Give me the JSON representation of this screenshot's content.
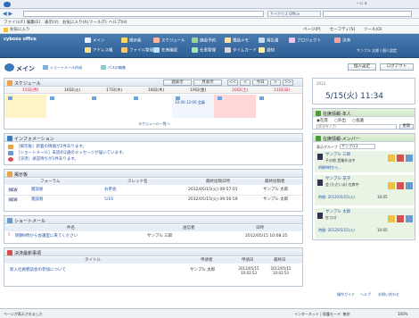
{
  "browser": {
    "nav_symbols": "◀ ▶",
    "menu": [
      "ファイル(F)",
      "編集(E)",
      "表示(V)",
      "お気に入り(A)",
      "ツール(T)",
      "ヘルプ(H)"
    ],
    "fav_label": "お気に入り",
    "tool_items": [
      "ページ(P)",
      "セーフティ(S)",
      "ツール(O)"
    ],
    "tab_title": "サイボウズ Office"
  },
  "app": {
    "logo": "cybozu office",
    "nav_row1": [
      "メイン",
      "掲示板",
      "スケジュール",
      "施設予約",
      "電話メモ",
      "報告書",
      "プロジェクト",
      "決済"
    ],
    "nav_row2": [
      "アドレス帳",
      "ファイル管理",
      "在席確認",
      "仕事管理",
      "タイムカード",
      "通知"
    ],
    "user_right": "サンプル 太郎 | 個人設定"
  },
  "breadcrumb": {
    "main": "メイン",
    "sub1": "ショートメール作成",
    "sub2": "パスの編集"
  },
  "header_buttons": {
    "personal": "個人設定",
    "logout": "ログアウト"
  },
  "schedule": {
    "title": "スケジュール",
    "views": [
      "週表示",
      "月表示"
    ],
    "pager": [
      "<<",
      "<",
      "今日",
      ">",
      ">>"
    ],
    "days": [
      "15日(月)",
      "16日(火)",
      "17日(水)",
      "18日(木)",
      "19日(金)",
      "20日(土)",
      "21日(日)"
    ],
    "event": "10:00-12:00 会議",
    "more": "スケジュール一覧へ"
  },
  "info": {
    "title": "インフォメーション",
    "items": [
      "［掲示板］新着の情報が2件あります。",
      "［ショートメール］未読の2通のメッセージが届いています。",
      "［決済］承認待ちが1件あります。"
    ]
  },
  "bbs": {
    "title": "掲示板",
    "columns": [
      "フォーラム",
      "スレッド名",
      "最終投稿日時",
      "最終投稿者"
    ],
    "rows": [
      {
        "badge": "NEW",
        "forum": "雑談板",
        "thread": "お茶会",
        "date": "2012/05/15(火) 09:57:01",
        "author": "サンプル 太郎"
      },
      {
        "badge": "NEW",
        "forum": "雑談板",
        "thread": "5/16",
        "date": "2012/05/15(火) 09:56:59",
        "author": "サンプル 太郎"
      }
    ]
  },
  "mail": {
    "title": "ショートメール",
    "columns": [
      "件名",
      "送信者",
      "日時"
    ],
    "rows": [
      {
        "subject": "明朝9時から会議室に来てください",
        "sender": "サンプル 三郎",
        "date": "2012/05/15 10:08:25"
      }
    ]
  },
  "approval": {
    "title": "決済最新事項",
    "columns": [
      "タイトル",
      "申請者",
      "申請日",
      "最終日"
    ],
    "rows": [
      {
        "title": "新入社員懇談会の参加について",
        "applicant": "サンプル 太郎",
        "applied": "2012/05/15 10:03:53",
        "last": "2012/05/15 10:03:53"
      }
    ]
  },
  "datetime": {
    "label": "2012",
    "value": "5/15(火) 11:34"
  },
  "presence": {
    "title": "在席情報-本人",
    "states": [
      "在席",
      "外出",
      "会議"
    ],
    "input_placeholder": "状況を入力",
    "button": "更新"
  },
  "members": {
    "title": "在席情報-メンバー",
    "group_label": "表示グループ",
    "group_value": "サンプル1",
    "people": [
      {
        "name": "サンプル 三郎",
        "status": "その他 営業外出中",
        "note": "明朝9時から...",
        "time": "2012/05/15(火) 10:08"
      },
      {
        "name": "サンプル 花子",
        "status": "会 (ただいま) 在席中",
        "note": "時間: 2012/05/15(火)",
        "time": "10:05"
      },
      {
        "name": "サンプル 太郎",
        "status": "在 (ロ)",
        "note": "時間: 2012/05/15(火)",
        "time": "10:05"
      }
    ]
  },
  "footer_links": [
    "操作ガイド",
    "ヘルプ",
    "お問い合わせ"
  ],
  "statusbar": {
    "text": "ページが表示されました",
    "zone": "インターネット | 保護モード: 無効",
    "zoom": "100%"
  }
}
